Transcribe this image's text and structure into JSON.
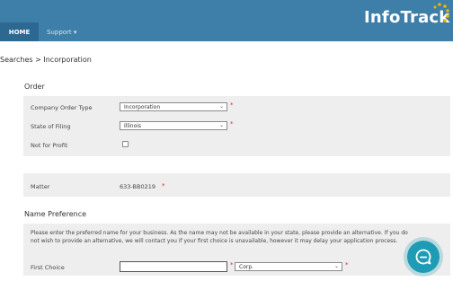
{
  "nav": {
    "home": "HOME",
    "support": "Support ▾"
  },
  "logo": {
    "text": "InfoTrack"
  },
  "breadcrumb": "Searches > Incorporation",
  "order": {
    "title": "Order",
    "company_order_type": {
      "label": "Company Order Type",
      "value": "Incorporation"
    },
    "state_of_filing": {
      "label": "State of Filing",
      "value": "Illinois"
    },
    "not_for_profit": {
      "label": "Not for Profit",
      "checked": false
    }
  },
  "matter": {
    "label": "Matter",
    "value": "633-BB0219",
    "required": "*"
  },
  "name_preference": {
    "title": "Name Preference",
    "note": "Please enter the preferred name for your business. As the name may not be available in your state, please provide an alternative. If you do not wish to provide an alternative, we will contact you if your first choice is unavailable, however it may delay your application process.",
    "first_choice": {
      "label": "First Choice",
      "value": "",
      "suffix": "Corp."
    }
  },
  "required_mark": "*",
  "colors": {
    "header": "#3d7fa8",
    "accent": "#1e9bb5",
    "required": "#d93025"
  }
}
